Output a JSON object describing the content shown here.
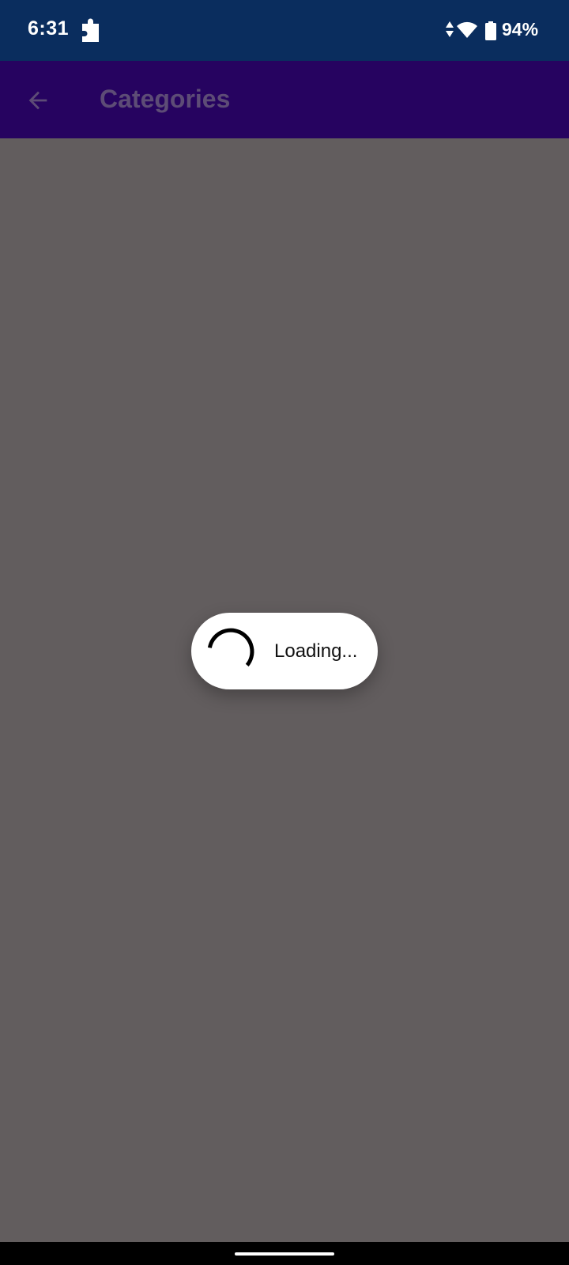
{
  "status_bar": {
    "time": "6:31",
    "battery_percent": "94%",
    "icons": [
      "puzzle-icon",
      "data-arrows-icon",
      "wifi-icon",
      "battery-icon"
    ]
  },
  "app_bar": {
    "title": "Categories",
    "back_icon": "arrow-left-icon"
  },
  "loading": {
    "label": "Loading..."
  },
  "colors": {
    "status_bar": "#0a2d5e",
    "app_bar": "#260360",
    "scrim": "#625d5e",
    "pill": "#ffffff",
    "nav_bar": "#000000"
  }
}
